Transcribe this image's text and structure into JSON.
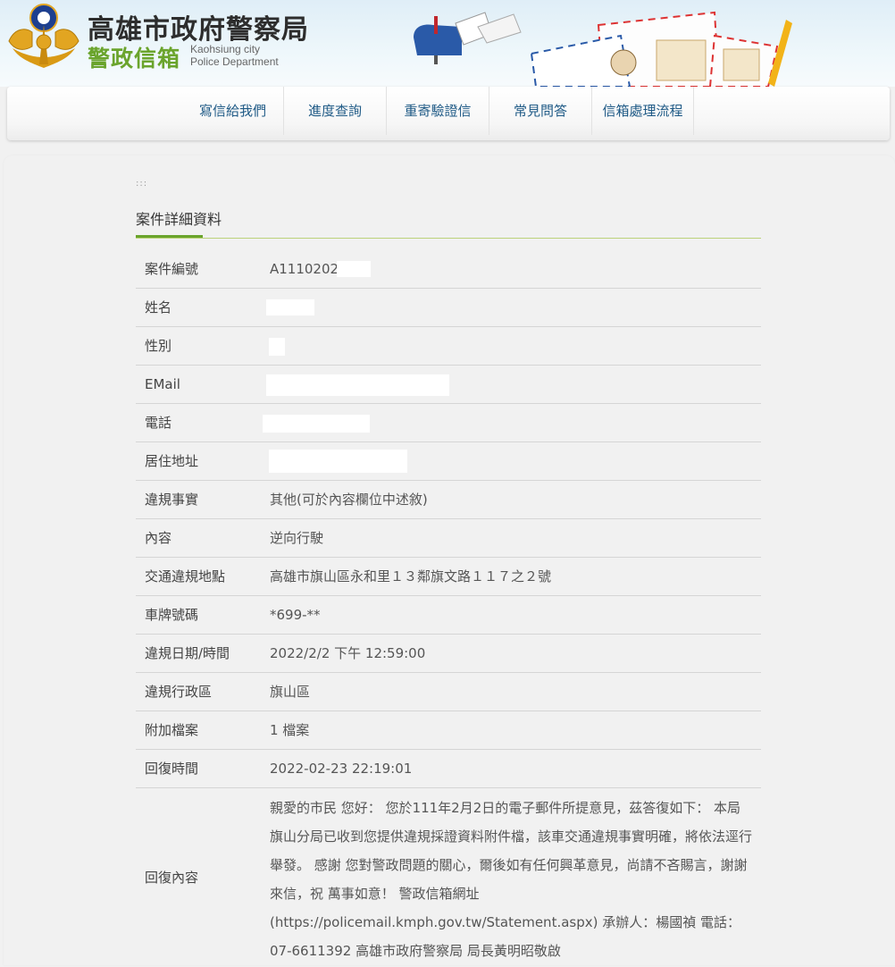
{
  "header": {
    "title": "高雄市政府警察局",
    "subtitle": "警政信箱",
    "subtitle_en_1": "Kaohsiung city",
    "subtitle_en_2": "Police Department"
  },
  "nav": {
    "items": [
      {
        "label": "寫信給我們"
      },
      {
        "label": "進度查詢"
      },
      {
        "label": "重寄驗證信"
      },
      {
        "label": "常見問答"
      },
      {
        "label": "信箱處理流程"
      }
    ]
  },
  "page": {
    "breadcrumb": ":::",
    "section_title": "案件詳細資料"
  },
  "details": {
    "case_no": {
      "label": "案件編號",
      "value": "A1110202"
    },
    "name": {
      "label": "姓名",
      "value": ""
    },
    "gender": {
      "label": "性別",
      "value": ""
    },
    "email": {
      "label": "EMail",
      "value": ""
    },
    "phone": {
      "label": "電話",
      "value": ""
    },
    "address": {
      "label": "居住地址",
      "value": ""
    },
    "violation": {
      "label": "違規事實",
      "value": "其他(可於內容欄位中述敘)"
    },
    "content": {
      "label": "內容",
      "value": "逆向行駛"
    },
    "location": {
      "label": "交通違規地點",
      "value": "高雄市旗山區永和里１３鄰旗文路１１７之２號"
    },
    "plate": {
      "label": "車牌號碼",
      "value": "*699-**"
    },
    "datetime": {
      "label": "違規日期/時間",
      "value": "2022/2/2 下午 12:59:00"
    },
    "district": {
      "label": "違規行政區",
      "value": "旗山區"
    },
    "attachment": {
      "label": "附加檔案",
      "value": "1 檔案"
    },
    "reply_time": {
      "label": "回復時間",
      "value": "2022-02-23 22:19:01"
    },
    "reply_content": {
      "label": "回復內容",
      "value": "親愛的市民 您好： 您於111年2月2日的電子郵件所提意見，茲答復如下： 本局旗山分局已收到您提供違規採證資料附件檔，該車交通違規事實明確，將依法逕行舉發。 感謝 您對警政問題的關心，爾後如有任何興革意見，尚請不吝賜言，謝謝來信，祝 萬事如意！ 警政信箱網址(https://policemail.kmph.gov.tw/Statement.aspx) 承辦人：楊國禎 電話：07-6611392 高雄市政府警察局 局長黃明昭敬啟"
    }
  },
  "colors": {
    "accent_green": "#6aa42c",
    "nav_text": "#1f5a86",
    "header_bg": "#e6f2f8"
  }
}
